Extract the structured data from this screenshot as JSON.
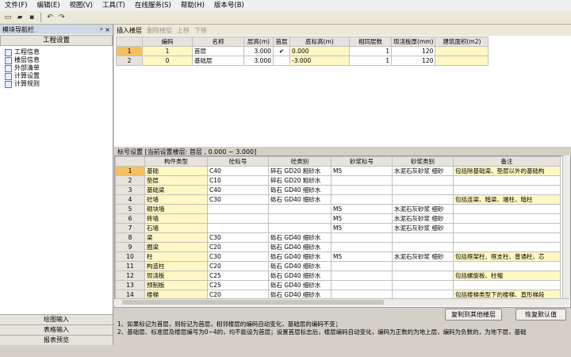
{
  "menu": [
    "文件(F)",
    "编辑(E)",
    "视图(V)",
    "工具(T)",
    "在线服务(S)",
    "帮助(H)",
    "版本号(B)"
  ],
  "left": {
    "title": "模块导航栏",
    "pin": "ᵖ",
    "close": "×",
    "header": "工程设置",
    "tree": [
      "工程信息",
      "楼层信息",
      "外部清单",
      "计算设置",
      "计算规则"
    ],
    "bottom": [
      "绘图输入",
      "表格输入",
      "报表预览"
    ]
  },
  "toolbar": {
    "insert": "插入楼层",
    "delete": "删除楼层",
    "up": "上移",
    "down": "下移"
  },
  "floor": {
    "headers": [
      "",
      "编码",
      "名称",
      "层高(m)",
      "首层",
      "底标高(m)",
      "相同层数",
      "现浇板厚(mm)",
      "建筑面积(m2)"
    ],
    "rows": [
      {
        "n": "1",
        "code": "1",
        "name": "首层",
        "h": "3.000",
        "first": "✔",
        "base": "0.000",
        "same": "1",
        "slab": "120",
        "area": ""
      },
      {
        "n": "2",
        "code": "0",
        "name": "基础层",
        "h": "3.000",
        "first": "",
        "base": "-3.000",
        "same": "1",
        "slab": "120",
        "area": ""
      }
    ]
  },
  "section_label": "标号设置 [当前设置楼层: 首层 , 0.000 ~ 3.000]",
  "grid": {
    "headers": [
      "",
      "构件类型",
      "砼标号",
      "砼类别",
      "砂浆标号",
      "砂浆类别",
      "备注"
    ],
    "rows": [
      [
        "1",
        "基础",
        "C40",
        "碎石 GD20 粗砂水",
        "M5",
        "水泥石灰砂浆 细砂",
        "包括除基础梁、垫层以外的基础构"
      ],
      [
        "2",
        "垫层",
        "C10",
        "碎石 GD20 粗砂水",
        "",
        "",
        ""
      ],
      [
        "3",
        "基础梁",
        "C40",
        "砾石 GD40 细砂水",
        "",
        "",
        ""
      ],
      [
        "4",
        "砼墙",
        "C30",
        "砾石 GD40 细砂水",
        "",
        "",
        "包括连梁、暗梁、端柱、暗柱"
      ],
      [
        "5",
        "砌块墙",
        "",
        "",
        "M5",
        "水泥石灰砂浆 细砂",
        ""
      ],
      [
        "6",
        "砖墙",
        "",
        "",
        "M5",
        "水泥石灰砂浆 细砂",
        ""
      ],
      [
        "7",
        "石墙",
        "",
        "",
        "M5",
        "水泥石灰砂浆 细砂",
        ""
      ],
      [
        "8",
        "梁",
        "C30",
        "砾石 GD40 细砂水",
        "",
        "",
        ""
      ],
      [
        "9",
        "圈梁",
        "C20",
        "砾石 GD40 细砂水",
        "",
        "",
        ""
      ],
      [
        "10",
        "柱",
        "C30",
        "砾石 GD40 细砂水",
        "M5",
        "水泥石灰砂浆 细砂",
        "包括框架柱、框支柱、普通柱、芯"
      ],
      [
        "11",
        "构造柱",
        "C20",
        "砾石 GD40 细砂水",
        "",
        "",
        ""
      ],
      [
        "12",
        "现浇板",
        "C25",
        "砾石 GD40 细砂水",
        "",
        "",
        "包括螺旋板、柱帽"
      ],
      [
        "13",
        "预制板",
        "C25",
        "砾石 GD40 细砂水",
        "",
        "",
        ""
      ],
      [
        "14",
        "楼梯",
        "C20",
        "砾石 GD40 细砂水",
        "",
        "",
        "包括楼梯类型下的楼梯、直形梯段"
      ]
    ]
  },
  "buttons": {
    "copy": "复制到其他楼层",
    "restore": "恢复默认值"
  },
  "notes": [
    "1、如果标记为首层，则标记为首层，相邻楼层的编码自动变化，基础层的编码不变；",
    "2、基础层、标准层及楼层编号为0~4的，均不能设为首层；设置首层标志后，楼层编码自动变化，编码为正数的为地上层，编码为负数的，为地下层，基础"
  ]
}
